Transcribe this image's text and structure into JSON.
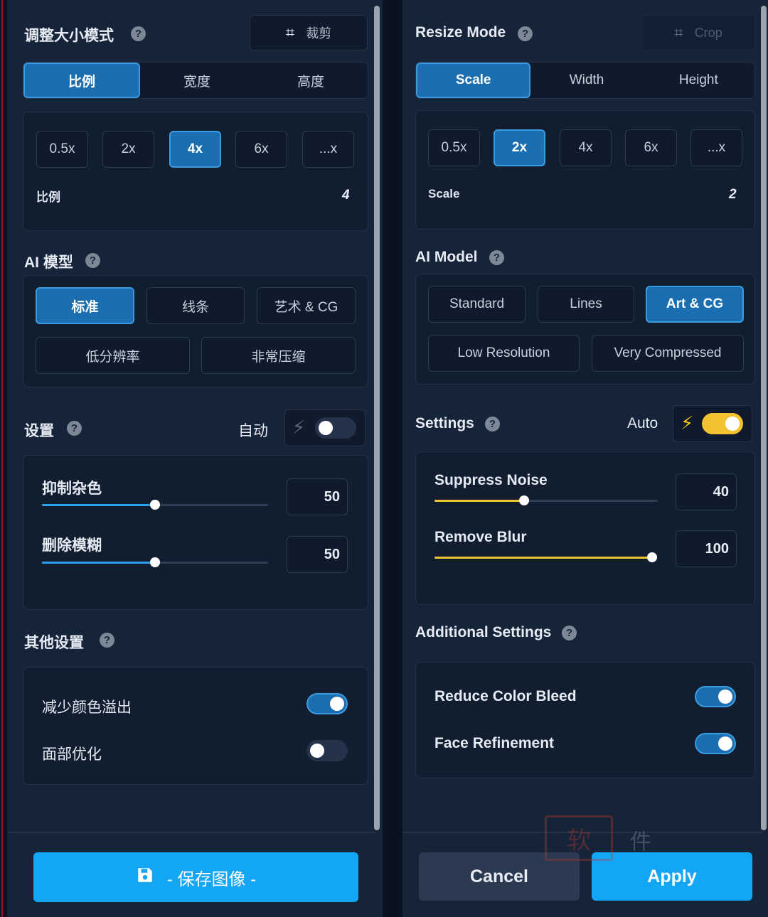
{
  "colors": {
    "panel_bg": "#152439",
    "accent_blue": "#1b6fb0",
    "primary_button": "#13a6f5",
    "slider_blue": "#2aa0ef",
    "slider_yellow": "#f2c230",
    "toggle_off": "#24334a",
    "bolt_off": "#5d6a7a",
    "bolt_on": "#f5c518"
  },
  "left": {
    "resize_mode": {
      "title": "调整大小模式",
      "help": "?",
      "crop_label": "裁剪",
      "crop_icon": "crop-icon"
    },
    "tabs": [
      "比例",
      "宽度",
      "高度"
    ],
    "active_tab": 0,
    "scale_chips": [
      "0.5x",
      "2x",
      "4x",
      "6x",
      "...x"
    ],
    "active_scale": 2,
    "scale_label": "比例",
    "scale_value": "4",
    "ai_model": {
      "title": "AI 模型",
      "help": "?"
    },
    "models_row1": [
      "标准",
      "线条",
      "艺术 & CG"
    ],
    "models_row2": [
      "低分辨率",
      "非常压缩"
    ],
    "active_model": 0,
    "settings": {
      "title": "设置",
      "help": "?",
      "auto_label": "自动",
      "auto_on": false
    },
    "sliders": [
      {
        "label": "抑制杂色",
        "value": "50",
        "percent": 50
      },
      {
        "label": "删除模糊",
        "value": "50",
        "percent": 50
      }
    ],
    "additional": {
      "title": "其他设置",
      "help": "?"
    },
    "options": [
      {
        "label": "减少颜色溢出",
        "on": true
      },
      {
        "label": "面部优化",
        "on": false
      }
    ],
    "save_button": {
      "label": "- 保存图像 -",
      "icon": "save-icon"
    }
  },
  "right": {
    "resize_mode": {
      "title": "Resize Mode",
      "help": "?",
      "crop_label": "Crop",
      "crop_icon": "crop-icon"
    },
    "tabs": [
      "Scale",
      "Width",
      "Height"
    ],
    "active_tab": 0,
    "scale_chips": [
      "0.5x",
      "2x",
      "4x",
      "6x",
      "...x"
    ],
    "active_scale": 1,
    "scale_label": "Scale",
    "scale_value": "2",
    "ai_model": {
      "title": "AI Model",
      "help": "?"
    },
    "models_row1": [
      "Standard",
      "Lines",
      "Art & CG"
    ],
    "models_row2": [
      "Low Resolution",
      "Very Compressed"
    ],
    "active_model": 2,
    "settings": {
      "title": "Settings",
      "help": "?",
      "auto_label": "Auto",
      "auto_on": true
    },
    "sliders": [
      {
        "label": "Suppress Noise",
        "value": "40",
        "percent": 40
      },
      {
        "label": "Remove Blur",
        "value": "100",
        "percent": 100
      }
    ],
    "additional": {
      "title": "Additional Settings",
      "help": "?"
    },
    "options": [
      {
        "label": "Reduce Color Bleed",
        "on": true
      },
      {
        "label": "Face Refinement",
        "on": true
      }
    ],
    "cancel_label": "Cancel",
    "apply_label": "Apply"
  },
  "watermark": {
    "seal_text": "软",
    "text": "件"
  }
}
